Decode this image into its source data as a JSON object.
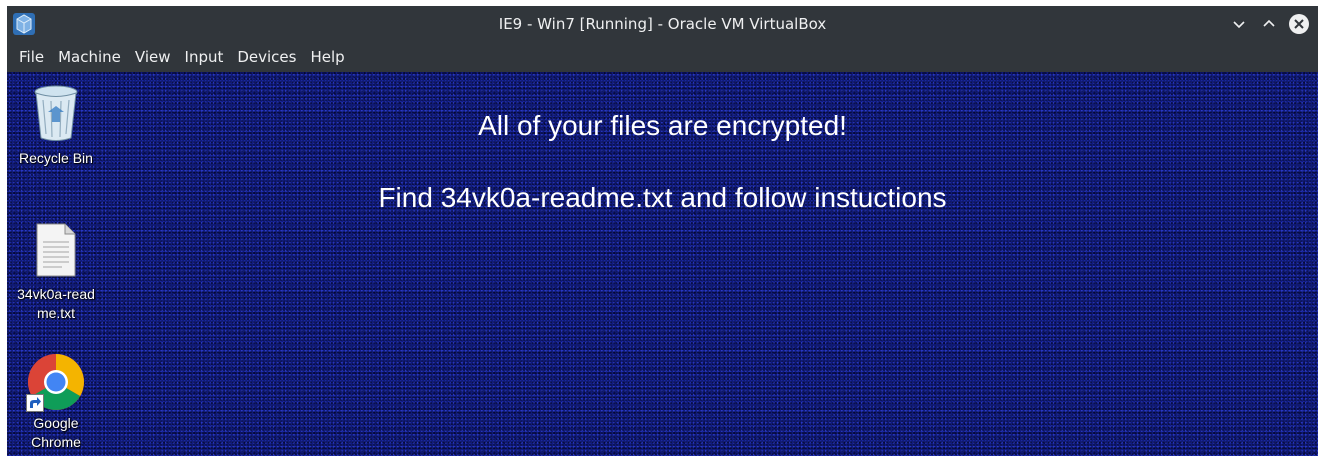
{
  "window": {
    "title": "IE9 - Win7 [Running] - Oracle VM VirtualBox",
    "app_icon": "virtualbox-icon",
    "controls": [
      "minimize-icon",
      "maximize-icon",
      "close-icon"
    ]
  },
  "menubar": {
    "items": [
      "File",
      "Machine",
      "View",
      "Input",
      "Devices",
      "Help"
    ]
  },
  "desktop": {
    "wallpaper_color": "#101a78",
    "message": {
      "line1": "All of your files are encrypted!",
      "line2": "Find 34vk0a-readme.txt and follow instuctions"
    },
    "icons": [
      {
        "label": "Recycle Bin",
        "icon": "recycle-bin-icon"
      },
      {
        "label": "34vk0a-readme.txt",
        "icon": "text-file-icon"
      },
      {
        "label": "Google Chrome",
        "icon": "chrome-icon"
      }
    ]
  },
  "colors": {
    "titlebar": "#31363b",
    "text": "#eff0f1"
  }
}
